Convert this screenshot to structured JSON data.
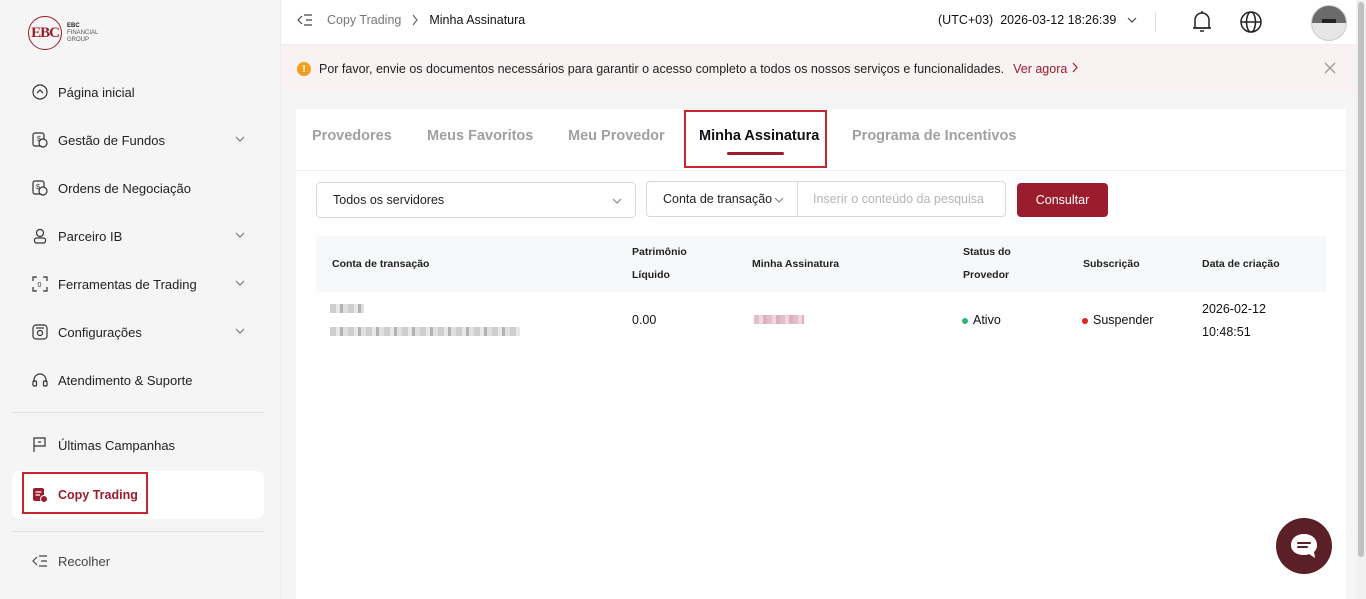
{
  "brand": {
    "logo_mark": "EBC",
    "line1": "EBC",
    "line2": "FINANCIAL",
    "line3": "GROUP"
  },
  "sidebar": {
    "items": [
      {
        "label": "Página inicial",
        "icon": "home-icon"
      },
      {
        "label": "Gestão de Fundos",
        "icon": "funds-icon",
        "expandable": true
      },
      {
        "label": "Ordens de Negociação",
        "icon": "orders-icon"
      },
      {
        "label": "Parceiro IB",
        "icon": "partner-icon",
        "expandable": true
      },
      {
        "label": "Ferramentas de Trading",
        "icon": "tools-icon",
        "expandable": true
      },
      {
        "label": "Configurações",
        "icon": "settings-icon",
        "expandable": true
      },
      {
        "label": "Atendimento & Suporte",
        "icon": "headset-icon"
      }
    ],
    "campaigns": "Últimas Campanhas",
    "copy_trading": "Copy Trading",
    "collapse": "Recolher"
  },
  "header": {
    "breadcrumb_1": "Copy Trading",
    "breadcrumb_2": "Minha Assinatura",
    "timezone": "(UTC+03)",
    "datetime": "2026-03-12 18:26:39"
  },
  "notice": {
    "text": "Por favor, envie os documentos necessários para garantir o acesso completo a todos os nossos serviços e funcionalidades.",
    "link": "Ver agora"
  },
  "tabs": [
    "Provedores",
    "Meus Favoritos",
    "Meu Provedor",
    "Minha Assinatura",
    "Programa de Incentivos"
  ],
  "filters": {
    "server": "Todos os servidores",
    "search_type": "Conta de transação",
    "search_placeholder": "Inserir o conteúdo da pesquisa",
    "query_button": "Consultar"
  },
  "table": {
    "headers": {
      "account": "Conta de transação",
      "equity_1": "Patrimônio",
      "equity_2": "Líquido",
      "subscription_name": "Minha Assinatura",
      "provider_status_1": "Status do",
      "provider_status_2": "Provedor",
      "subscription": "Subscrição",
      "created": "Data de criação"
    },
    "rows": [
      {
        "equity": "0.00",
        "provider_status": "Ativo",
        "subscription": "Suspender",
        "created_date": "2026-02-12",
        "created_time": "10:48:51"
      }
    ]
  },
  "colors": {
    "brand": "#9b1c2c",
    "active": "#2bb673",
    "suspended": "#e02424"
  }
}
